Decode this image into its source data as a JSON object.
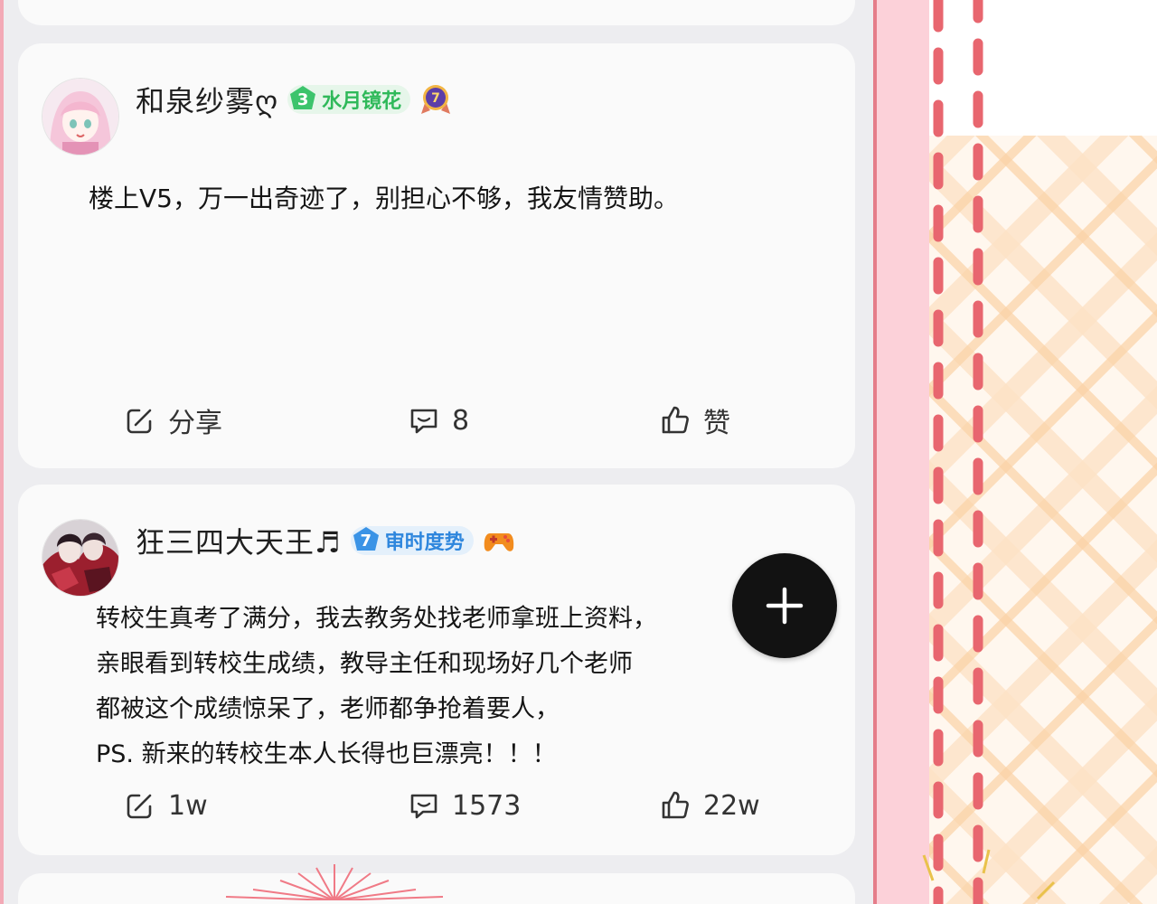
{
  "posts": [
    {
      "username": "和泉纱雾ღ",
      "level_number": "3",
      "level_title": "水月镜花",
      "medal_number": "7",
      "text": "楼上V5，万一出奇迹了，别担心不够，我友情赞助。",
      "share_label": "分享",
      "comment_count": "8",
      "like_label": "赞"
    },
    {
      "username": "狂三四大天王♬",
      "level_number": "7",
      "level_title": "审时度势",
      "text_lines": [
        "转校生真考了满分，我去教务处找老师拿班上资料，",
        "亲眼看到转校生成绩，教导主任和现场好几个老师",
        "都被这个成绩惊呆了，老师都争抢着要人，",
        "PS. 新来的转校生本人长得也巨漂亮！！！"
      ],
      "share_count": "1w",
      "comment_count": "1573",
      "like_count": "22w"
    }
  ],
  "icons": {
    "share": "share-icon",
    "comment": "comment-icon",
    "like": "thumbs-up-icon",
    "fab": "plus-icon",
    "medal_purple": "purple-medal-icon",
    "gamepad": "gamepad-icon"
  },
  "colors": {
    "level_green": "#2fb95a",
    "level_blue": "#2e86dd",
    "fab": "#121212",
    "dash_red": "#e8666f",
    "panel_pink": "#fcd1d9"
  }
}
